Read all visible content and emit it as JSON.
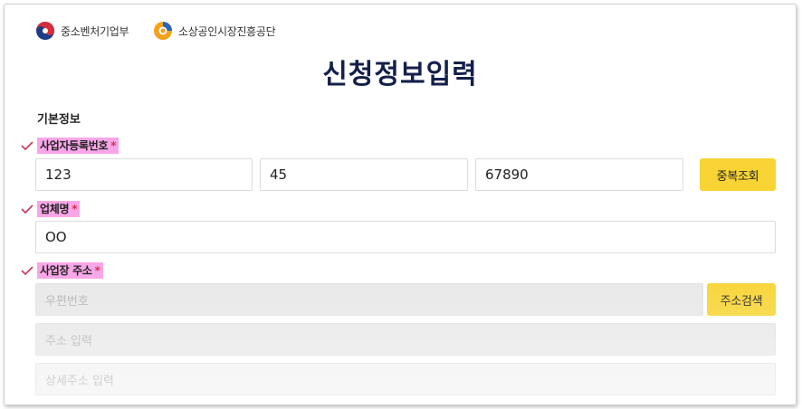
{
  "header": {
    "logo1_text": "중소벤처기업부",
    "logo2_text": "소상공인시장진흥공단"
  },
  "page_title": "신청정보입력",
  "section_title": "기본정보",
  "required_mark": "*",
  "business_number": {
    "label": "사업자등록번호",
    "part1": "123",
    "part2": "45",
    "part3": "67890",
    "check_button": "중복조회"
  },
  "company_name": {
    "label": "업체명",
    "value": "OO"
  },
  "address": {
    "label": "사업장 주소",
    "zip_placeholder": "우편번호",
    "search_button": "주소검색",
    "addr_placeholder": "주소 입력",
    "detail_placeholder": "상세주소 입력"
  },
  "colors": {
    "accent_yellow": "#f7d433",
    "highlight_pink": "#f9a6e8",
    "title_navy": "#14204a",
    "check_red": "#c0395a"
  }
}
